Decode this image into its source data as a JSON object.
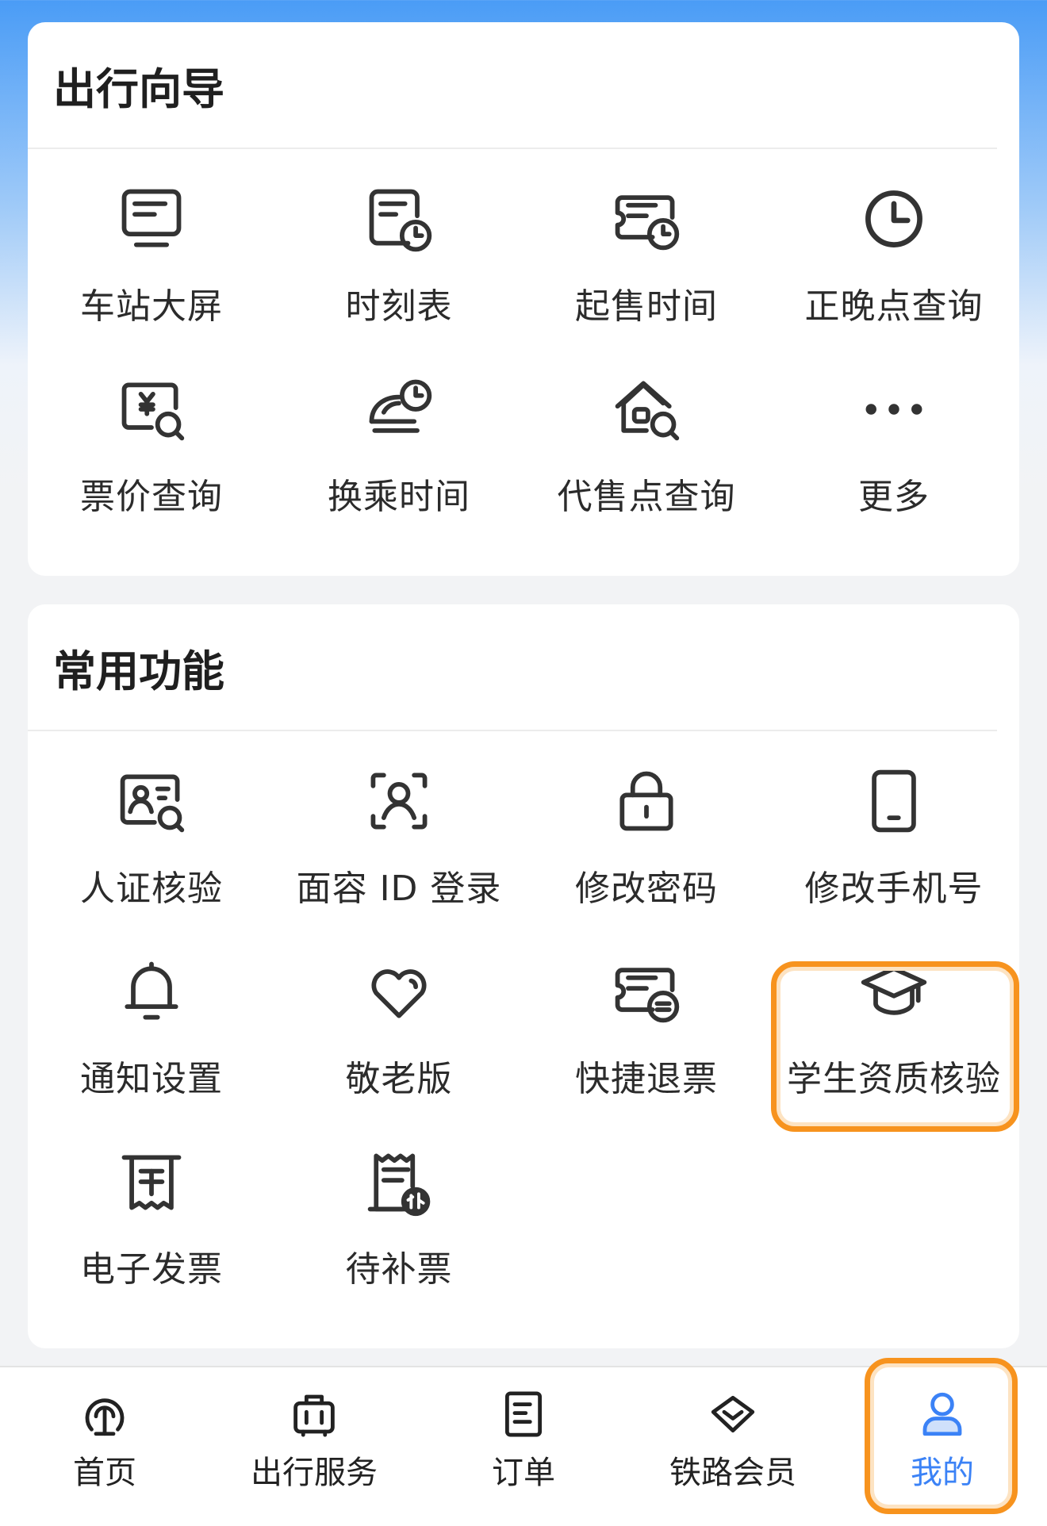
{
  "travel_guide": {
    "title": "出行向导",
    "items": [
      {
        "label": "车站大屏",
        "icon": "station-screen-icon"
      },
      {
        "label": "时刻表",
        "icon": "timetable-icon"
      },
      {
        "label": "起售时间",
        "icon": "sale-time-icon"
      },
      {
        "label": "正晚点查询",
        "icon": "clock-icon"
      },
      {
        "label": "票价查询",
        "icon": "fare-search-icon"
      },
      {
        "label": "换乘时间",
        "icon": "transfer-time-icon"
      },
      {
        "label": "代售点查询",
        "icon": "agency-search-icon"
      },
      {
        "label": "更多",
        "icon": "more-icon"
      }
    ]
  },
  "common_functions": {
    "title": "常用功能",
    "items": [
      {
        "label": "人证核验",
        "icon": "id-verify-icon"
      },
      {
        "label": "面容 ID 登录",
        "icon": "face-id-icon"
      },
      {
        "label": "修改密码",
        "icon": "lock-icon"
      },
      {
        "label": "修改手机号",
        "icon": "phone-icon"
      },
      {
        "label": "通知设置",
        "icon": "bell-icon"
      },
      {
        "label": "敬老版",
        "icon": "heart-icon"
      },
      {
        "label": "快捷退票",
        "icon": "quick-refund-icon"
      },
      {
        "label": "学生资质核验",
        "icon": "graduation-cap-icon"
      },
      {
        "label": "电子发票",
        "icon": "invoice-icon"
      },
      {
        "label": "待补票",
        "icon": "supplement-ticket-icon"
      }
    ]
  },
  "tabbar": {
    "items": [
      {
        "label": "首页",
        "icon": "train-logo-icon"
      },
      {
        "label": "出行服务",
        "icon": "luggage-icon"
      },
      {
        "label": "订单",
        "icon": "order-icon"
      },
      {
        "label": "铁路会员",
        "icon": "diamond-icon"
      },
      {
        "label": "我的",
        "icon": "user-icon"
      }
    ],
    "active_index": 4
  },
  "colors": {
    "accent": "#3b82f6",
    "highlight": "#f7931e",
    "icon": "#333333"
  }
}
